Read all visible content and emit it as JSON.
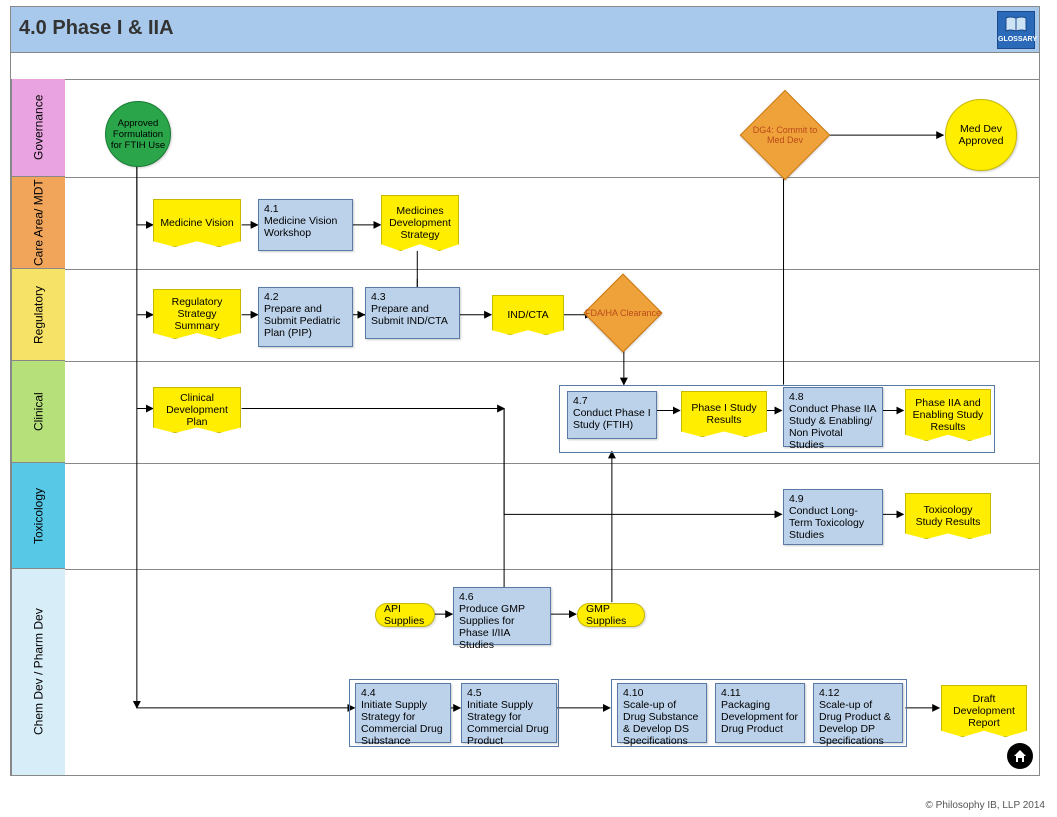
{
  "title": "4.0 Phase I & IIA",
  "glossary_label": "GLOSSARY",
  "lanes": {
    "gov": "Governance",
    "care": "Care Area/ MDT",
    "reg": "Regulatory",
    "clin": "Clinical",
    "tox": "Toxicology",
    "chem": "Chem Dev / Pharm Dev"
  },
  "nodes": {
    "approved_formulation": "Approved Formulation for FTIH Use",
    "dg4": "DG4: Commit to Med Dev",
    "meddev_approved": "Med Dev Approved",
    "medicine_vision": "Medicine Vision",
    "n41": "4.1\nMedicine Vision Workshop",
    "medicines_dev_strategy": "Medicines Development Strategy",
    "reg_strategy_summary": "Regulatory Strategy Summary",
    "n42": "4.2\nPrepare and Submit Pediatric Plan (PIP)",
    "n43": "4.3\nPrepare and Submit IND/CTA",
    "ind_cta": "IND/CTA",
    "fda_ha": "FDA/HA Clearance",
    "clinical_dev_plan": "Clinical Development Plan",
    "n47": "4.7\nConduct Phase I Study (FTIH)",
    "phase1_results": "Phase I Study Results",
    "n48": "4.8\nConduct Phase IIA Study & Enabling/ Non Pivotal Studies",
    "phase2a_results": "Phase IIA and Enabling Study Results",
    "n49": "4.9\nConduct Long-Term Toxicology Studies",
    "tox_results": "Toxicology Study Results",
    "api_supplies": "API Supplies",
    "n46": "4.6\nProduce GMP Supplies for Phase I/IIA Studies",
    "gmp_supplies": "GMP Supplies",
    "n44": "4.4\nInitiate Supply Strategy for Commercial Drug Substance",
    "n45": "4.5\nInitiate Supply Strategy for Commercial Drug Product",
    "n410": "4.10\nScale-up of Drug Substance & Develop DS Specifications",
    "n411": "4.11\nPackaging Development for Drug Product",
    "n412": "4.12\nScale-up of Drug Product & Develop DP Specifications",
    "draft_dev_report": "Draft Development Report"
  },
  "footer": "© Philosophy IB, LLP 2014"
}
